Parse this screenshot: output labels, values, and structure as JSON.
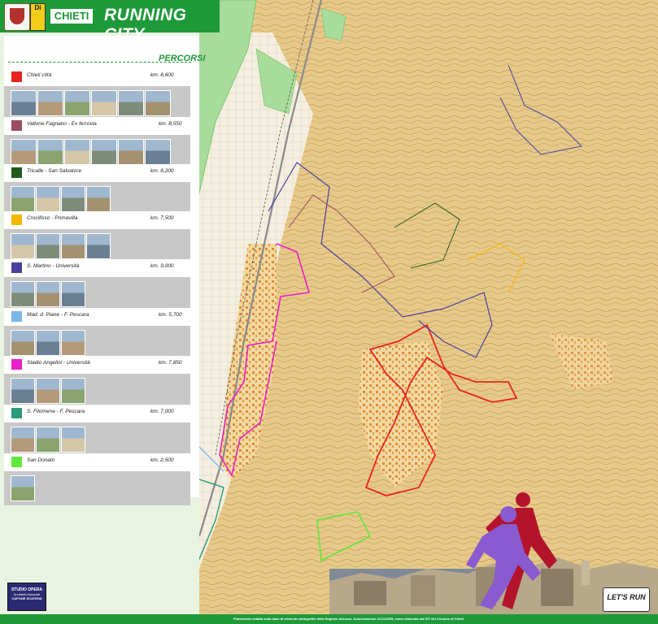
{
  "header": {
    "city": "CHIETI",
    "title": "RUNNING CITY",
    "logo_text": "Di"
  },
  "legend": {
    "title": "PERCORSI",
    "routes": [
      {
        "name": "Chieti città",
        "distance": "km. 8,600",
        "color": "#e8231f",
        "photos": 6
      },
      {
        "name": "Vallone Fagnano - Ex ferrovia",
        "distance": "km. 8,550",
        "color": "#9c4a62",
        "photos": 6
      },
      {
        "name": "Tricalle - San Salvatore",
        "distance": "km. 6,200",
        "color": "#1f5a1a",
        "photos": 4
      },
      {
        "name": "Crocifisso - Primavilla",
        "distance": "km. 7,500",
        "color": "#f5b800",
        "photos": 4
      },
      {
        "name": "S. Martino - Università",
        "distance": "km. 9,000",
        "color": "#4b3fa0",
        "photos": 3
      },
      {
        "name": "Mad. d. Piane - F. Pescara",
        "distance": "km. 5,700",
        "color": "#7db7e8",
        "photos": 3
      },
      {
        "name": "Stadio Angelini - Università",
        "distance": "km. 7,850",
        "color": "#e820c8",
        "photos": 3
      },
      {
        "name": "S. Filomena - F. Pescara",
        "distance": "km. 7,000",
        "color": "#2a9a7a",
        "photos": 3
      },
      {
        "name": "San Donato",
        "distance": "km. 2,500",
        "color": "#5fe83a",
        "photos": 1
      }
    ]
  },
  "logos": {
    "studio": "STUDIO OPERA",
    "studio_sub": "Architetti Associati",
    "studio_sub2": "CAPONE SCATENA",
    "letsrun": "LET'S RUN"
  },
  "footer": {
    "center": "Planimetria redatta sulla base di elementi cartografici della Regione Abruzzo. Autorizzazione 11/11/2005, come elaborata dal SIT del Comune di Chieti"
  },
  "colors": {
    "brand_green": "#1f9a3a",
    "terrain": "#d9b46a",
    "park": "#a8dc9a"
  }
}
